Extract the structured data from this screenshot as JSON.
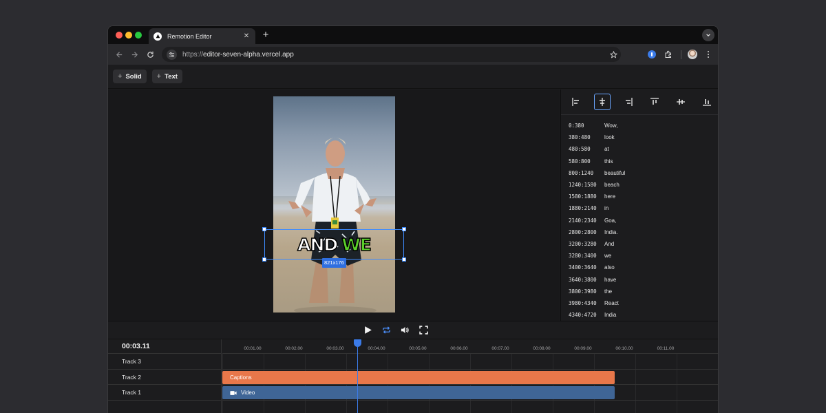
{
  "browser": {
    "tab_title": "Remotion Editor",
    "url_scheme": "https://",
    "url_host": "editor-seven-alpha.vercel.app"
  },
  "toolbar": {
    "solid_label": "Solid",
    "text_label": "Text"
  },
  "canvas": {
    "caption_word_1": "AND",
    "caption_word_2": "WE",
    "size_badge": "821x176",
    "caption_highlight_color": "#5bd02a",
    "selection_color": "#3d8bff"
  },
  "words": [
    {
      "time": "0:380",
      "word": "Wow,"
    },
    {
      "time": "380:480",
      "word": "look"
    },
    {
      "time": "480:580",
      "word": "at"
    },
    {
      "time": "580:800",
      "word": "this"
    },
    {
      "time": "800:1240",
      "word": "beautiful"
    },
    {
      "time": "1240:1580",
      "word": "beach"
    },
    {
      "time": "1580:1880",
      "word": "here"
    },
    {
      "time": "1880:2140",
      "word": "in"
    },
    {
      "time": "2140:2340",
      "word": "Goa,"
    },
    {
      "time": "2800:2800",
      "word": "India."
    },
    {
      "time": "3200:3280",
      "word": "And"
    },
    {
      "time": "3280:3400",
      "word": "we"
    },
    {
      "time": "3400:3640",
      "word": "also"
    },
    {
      "time": "3640:3800",
      "word": "have"
    },
    {
      "time": "3800:3980",
      "word": "the"
    },
    {
      "time": "3980:4340",
      "word": "React"
    },
    {
      "time": "4340:4720",
      "word": "India"
    }
  ],
  "timeline": {
    "timecode": "00:03.11",
    "ticks": [
      "00:01.00",
      "00:02.00",
      "00:03.00",
      "00:04.00",
      "00:05.00",
      "00:06.00",
      "00:07.00",
      "00:08.00",
      "00:09.00",
      "00:10.00",
      "00:11.00"
    ],
    "tracks": [
      "Track 3",
      "Track 2",
      "Track 1"
    ],
    "captions_clip_label": "Captions",
    "video_clip_label": "Video",
    "captions_color": "#e8774a",
    "video_color": "#3f6596",
    "playhead_color": "#3b7be8"
  }
}
